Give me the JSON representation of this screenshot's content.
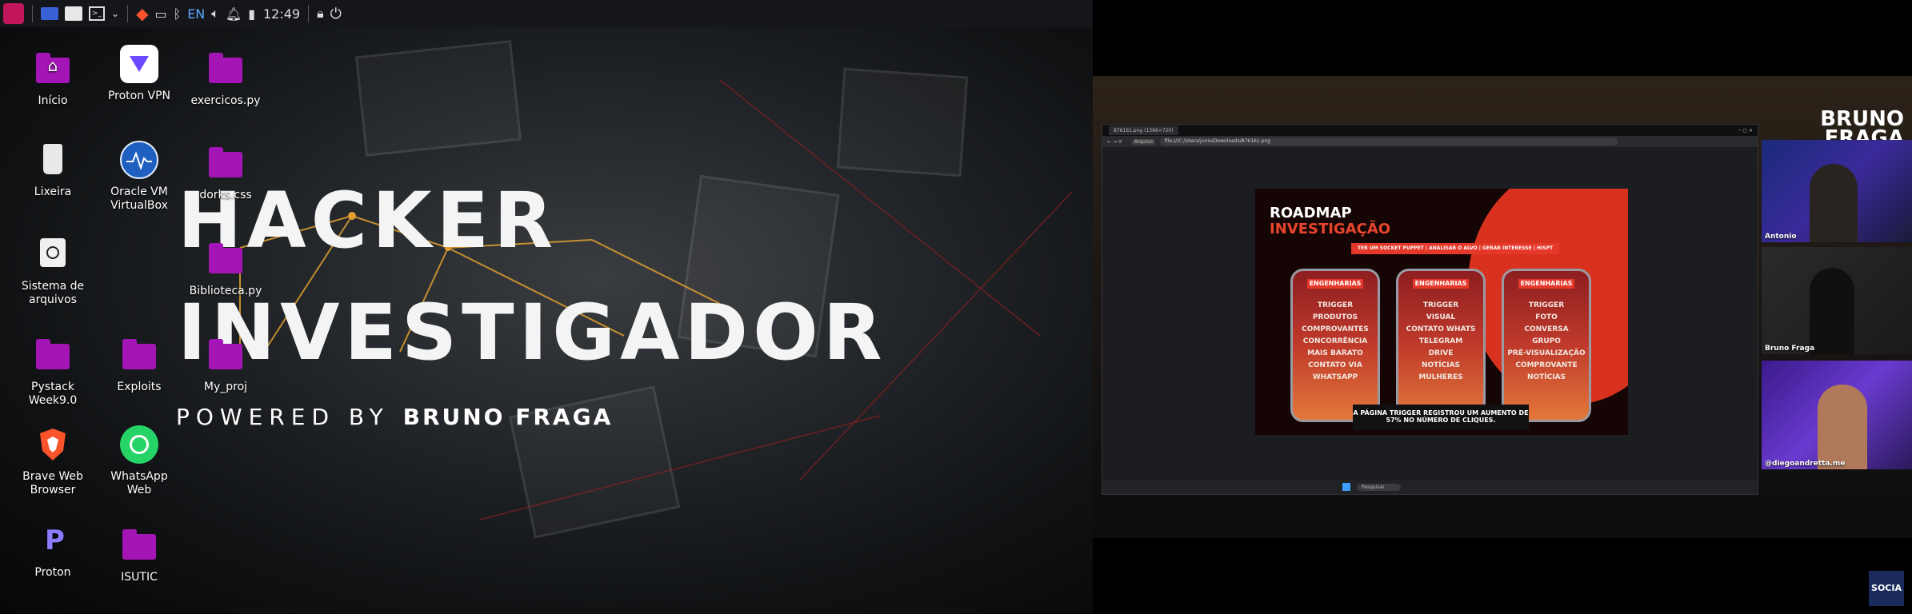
{
  "taskbar": {
    "clock": "12:49",
    "keyboard_layout": "EN"
  },
  "desktop": {
    "icons": [
      {
        "label": "Início",
        "type": "home-folder"
      },
      {
        "label": "Proton VPN",
        "type": "app"
      },
      {
        "label": "exercicos.py",
        "type": "folder"
      },
      {
        "label": "Lixeira",
        "type": "trash"
      },
      {
        "label": "Oracle VM VirtualBox",
        "type": "app"
      },
      {
        "label": "dorks.css",
        "type": "folder"
      },
      {
        "label": "Sistema de arquivos",
        "type": "drive"
      },
      {
        "label": "Biblioteca.py",
        "type": "folder"
      },
      {
        "label": "Pystack Week9.0",
        "type": "folder"
      },
      {
        "label": "Exploits",
        "type": "folder"
      },
      {
        "label": "My_proj",
        "type": "folder"
      },
      {
        "label": "Brave Web Browser",
        "type": "app"
      },
      {
        "label": "WhatsApp Web",
        "type": "app"
      },
      {
        "label": "Proton",
        "type": "app"
      },
      {
        "label": "ISUTIC",
        "type": "folder"
      }
    ]
  },
  "wallpaper": {
    "title_line1": "HACKER",
    "title_line2": "INVESTIGADOR",
    "tagline_prefix": "POWERED BY",
    "tagline_name": "BRUNO FRAGA"
  },
  "stream": {
    "brand_line1": "BRUNO",
    "brand_line2": "FRAGA",
    "browser": {
      "tab_title": "876161.png (1366×720)",
      "url": "file:///C:/Users/junio/Downloads/876161.png",
      "url_badge": "Arquivo",
      "search_placeholder": "Pesquisar"
    },
    "slide": {
      "title1": "ROADMAP",
      "title2": "INVESTIGAÇÃO",
      "banner": "TER UM SOCKET PUPPET | ANALISAR O ALVO | GERAR INTERESSE | HISPT",
      "phones": [
        {
          "tag": "ENGENHARIAS",
          "items": [
            "TRIGGER",
            "PRODUTOS",
            "COMPROVANTES",
            "CONCORRÊNCIA",
            "MAIS BARATO",
            "CONTATO VIA",
            "WHATSAPP"
          ]
        },
        {
          "tag": "ENGENHARIAS",
          "items": [
            "TRIGGER",
            "VISUAL",
            "CONTATO WHATS",
            "TELEGRAM",
            "DRIVE",
            "NOTÍCIAS",
            "MULHERES"
          ]
        },
        {
          "tag": "ENGENHARIAS",
          "items": [
            "TRIGGER",
            "FOTO",
            "CONVERSA",
            "GRUPO",
            "PRÉ-VISUALIZAÇÃO",
            "COMPROVANTE",
            "NOTÍCIAS"
          ]
        }
      ],
      "footer_line1": "A PÁGINA TRIGGER REGISTROU UM AUMENTO DE",
      "footer_line2": "57% NO NÚMERO DE CLIQUES."
    },
    "participants": [
      {
        "name": "Antonio"
      },
      {
        "name": "Bruno Fraga"
      },
      {
        "name": "@diegoandretta.me"
      }
    ],
    "corner_logo": "SOCIA"
  },
  "colors": {
    "folder": "#a315b5",
    "accent_red": "#e5382a",
    "web_lines": "#e0a030"
  }
}
